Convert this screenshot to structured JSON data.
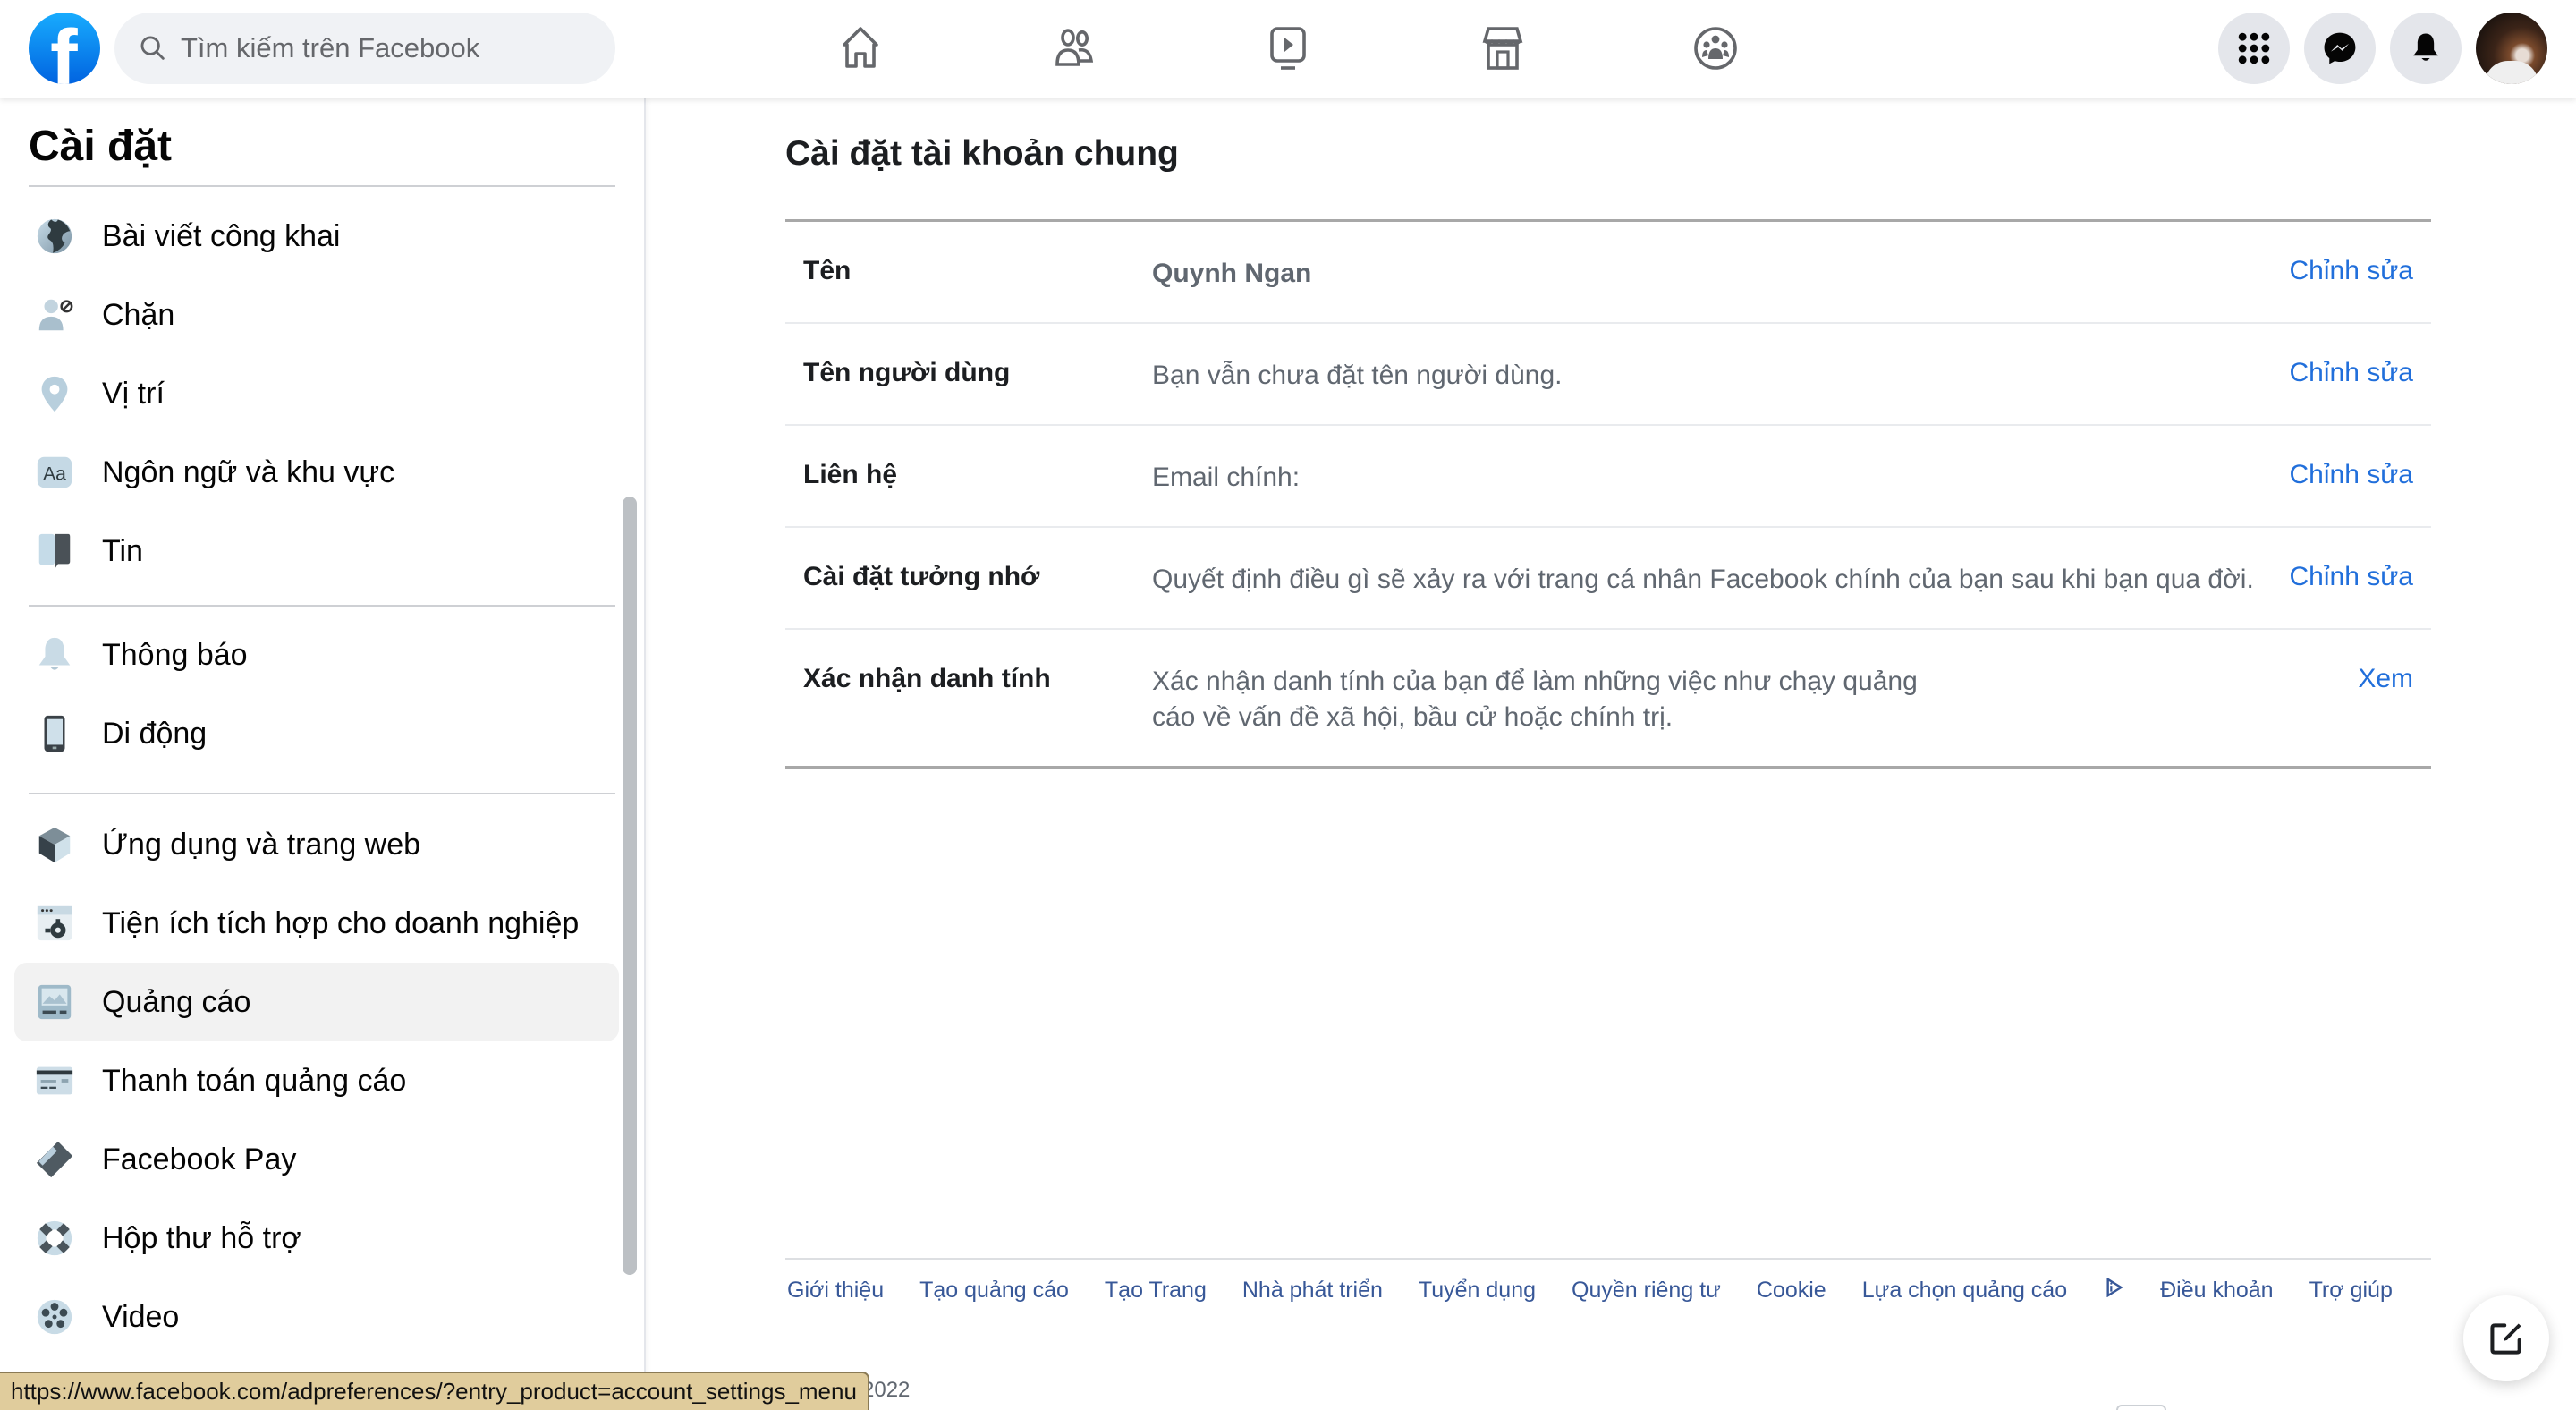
{
  "header": {
    "logo": "facebook-logo",
    "search": {
      "placeholder": "Tìm kiếm trên Facebook",
      "icon": "search-icon"
    },
    "nav": [
      {
        "name": "home",
        "icon": "home-icon"
      },
      {
        "name": "friends",
        "icon": "friends-icon"
      },
      {
        "name": "watch",
        "icon": "video-icon"
      },
      {
        "name": "marketplace",
        "icon": "store-icon"
      },
      {
        "name": "groups",
        "icon": "groups-icon"
      }
    ],
    "right_buttons": [
      {
        "name": "menu",
        "icon": "grid-icon"
      },
      {
        "name": "messenger",
        "icon": "messenger-icon"
      },
      {
        "name": "notifications",
        "icon": "bell-icon"
      },
      {
        "name": "account",
        "icon": "avatar"
      }
    ]
  },
  "sidebar": {
    "title": "Cài đặt",
    "groups": [
      [
        {
          "label": "Bài viết công khai",
          "icon": "globe-icon"
        },
        {
          "label": "Chặn",
          "icon": "block-user-icon"
        },
        {
          "label": "Vị trí",
          "icon": "location-pin-icon"
        },
        {
          "label": "Ngôn ngữ và khu vực",
          "icon": "language-icon"
        },
        {
          "label": "Tin",
          "icon": "stories-icon"
        }
      ],
      [
        {
          "label": "Thông báo",
          "icon": "bell-icon"
        },
        {
          "label": "Di động",
          "icon": "phone-icon"
        }
      ],
      [
        {
          "label": "Ứng dụng và trang web",
          "icon": "cube-icon"
        },
        {
          "label": "Tiện ích tích hợp cho doanh nghiệp",
          "icon": "business-integration-icon"
        },
        {
          "label": "Quảng cáo",
          "icon": "ads-icon",
          "active": true
        },
        {
          "label": "Thanh toán quảng cáo",
          "icon": "credit-card-icon"
        },
        {
          "label": "Facebook Pay",
          "icon": "pay-card-icon"
        },
        {
          "label": "Hộp thư hỗ trợ",
          "icon": "lifebuoy-icon"
        },
        {
          "label": "Video",
          "icon": "film-reel-icon"
        }
      ]
    ]
  },
  "main": {
    "title": "Cài đặt tài khoản chung",
    "rows": [
      {
        "key": "Tên",
        "value": "Quynh Ngan",
        "action": "Chỉnh sửa"
      },
      {
        "key": "Tên người dùng",
        "value": "Bạn vẫn chưa đặt tên người dùng.",
        "action": "Chỉnh sửa"
      },
      {
        "key": "Liên hệ",
        "value": "Email chính:",
        "action": "Chỉnh sửa"
      },
      {
        "key": "Cài đặt tưởng nhớ",
        "value": "Quyết định điều gì sẽ xảy ra với trang cá nhân Facebook chính của bạn sau khi bạn qua đời.",
        "action": "Chỉnh sửa"
      },
      {
        "key": "Xác nhận danh tính",
        "value": "Xác nhận danh tính của bạn để làm những việc như chạy quảng cáo về vấn đề xã hội, bầu cử hoặc chính trị.",
        "action": "Xem"
      }
    ]
  },
  "footer": {
    "links": [
      "Giới thiệu",
      "Tạo quảng cáo",
      "Tạo Trang",
      "Nhà phát triển",
      "Tuyển dụng",
      "Quyền riêng tư",
      "Cookie",
      "Lựa chọn quảng cáo",
      "Điều khoản",
      "Trợ giúp"
    ],
    "copyright": "2022"
  },
  "status_bar": {
    "url": "https://www.facebook.com/adpreferences/?entry_product=account_settings_menu"
  },
  "colors": {
    "brand": "#1877f2",
    "link": "#216fdb",
    "footer_link": "#385898",
    "active_item_bg": "#f2f2f2"
  }
}
